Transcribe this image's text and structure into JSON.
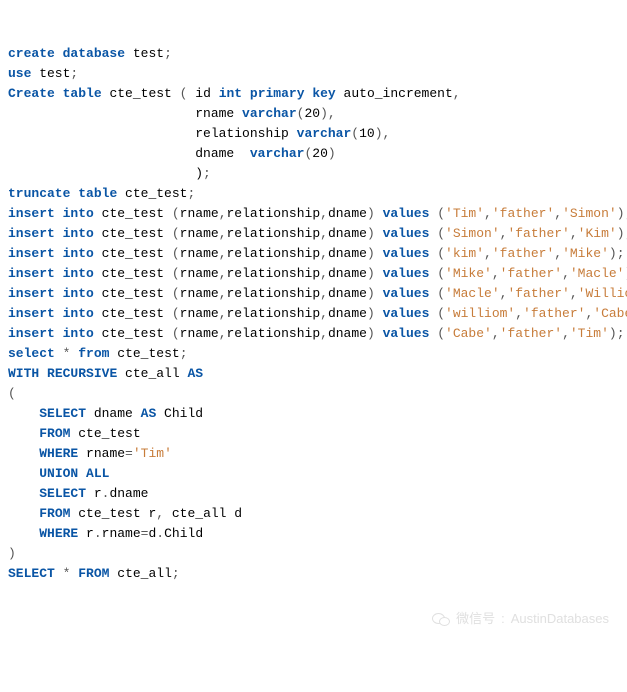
{
  "code": {
    "lines": [
      [
        [
          "create",
          "kw"
        ],
        [
          " ",
          "p"
        ],
        [
          "database",
          "kw"
        ],
        [
          " test",
          ""
        ],
        [
          ";",
          "p"
        ]
      ],
      [
        [
          "use",
          "kw"
        ],
        [
          " test",
          ""
        ],
        [
          ";",
          "p"
        ]
      ],
      [
        [
          "Create",
          "kw"
        ],
        [
          " ",
          "p"
        ],
        [
          "table",
          "kw"
        ],
        [
          " cte_test ",
          ""
        ],
        [
          "(",
          "p"
        ],
        [
          " id ",
          ""
        ],
        [
          "int",
          "kw"
        ],
        [
          " ",
          "p"
        ],
        [
          "primary",
          "kw"
        ],
        [
          " ",
          "p"
        ],
        [
          "key",
          "kw"
        ],
        [
          " auto_increment",
          ""
        ],
        [
          ",",
          "p"
        ]
      ],
      [
        [
          "                        rname ",
          ""
        ],
        [
          "varchar",
          "kw"
        ],
        [
          "(",
          "p"
        ],
        [
          "20",
          ""
        ],
        [
          ")",
          "p"
        ],
        [
          ",",
          "p"
        ]
      ],
      [
        [
          "                        relationship ",
          ""
        ],
        [
          "varchar",
          "kw"
        ],
        [
          "(",
          "p"
        ],
        [
          "10",
          ""
        ],
        [
          ")",
          "p"
        ],
        [
          ",",
          "p"
        ]
      ],
      [
        [
          "                        dname  ",
          ""
        ],
        [
          "varchar",
          "kw"
        ],
        [
          "(",
          "p"
        ],
        [
          "20",
          ""
        ],
        [
          ")",
          "p"
        ]
      ],
      [
        [
          "                        )",
          ""
        ],
        [
          ";",
          "p"
        ]
      ],
      [
        [
          "truncate",
          "kw"
        ],
        [
          " ",
          "p"
        ],
        [
          "table",
          "kw"
        ],
        [
          " cte_test",
          ""
        ],
        [
          ";",
          "p"
        ]
      ],
      [
        [
          "insert",
          "kw"
        ],
        [
          " ",
          "p"
        ],
        [
          "into",
          "kw"
        ],
        [
          " cte_test ",
          ""
        ],
        [
          "(",
          "p"
        ],
        [
          "rname",
          ""
        ],
        [
          ",",
          "p"
        ],
        [
          "relationship",
          ""
        ],
        [
          ",",
          "p"
        ],
        [
          "dname",
          ""
        ],
        [
          ")",
          "p"
        ],
        [
          " ",
          "p"
        ],
        [
          "values",
          "kw"
        ],
        [
          " ",
          "p"
        ],
        [
          "(",
          "p"
        ],
        [
          "'Tim'",
          "str"
        ],
        [
          ",",
          "p"
        ],
        [
          "'father'",
          "str"
        ],
        [
          ",",
          "p"
        ],
        [
          "'Simon'",
          "str"
        ],
        [
          ")",
          "p"
        ],
        [
          ";",
          "p"
        ]
      ],
      [
        [
          "insert",
          "kw"
        ],
        [
          " ",
          "p"
        ],
        [
          "into",
          "kw"
        ],
        [
          " cte_test ",
          ""
        ],
        [
          "(",
          "p"
        ],
        [
          "rname",
          ""
        ],
        [
          ",",
          "p"
        ],
        [
          "relationship",
          ""
        ],
        [
          ",",
          "p"
        ],
        [
          "dname",
          ""
        ],
        [
          ")",
          "p"
        ],
        [
          " ",
          "p"
        ],
        [
          "values",
          "kw"
        ],
        [
          " ",
          "p"
        ],
        [
          "(",
          "p"
        ],
        [
          "'Simon'",
          "str"
        ],
        [
          ",",
          "p"
        ],
        [
          "'father'",
          "str"
        ],
        [
          ",",
          "p"
        ],
        [
          "'Kim'",
          "str"
        ],
        [
          ")",
          "p"
        ],
        [
          ";",
          "p"
        ]
      ],
      [
        [
          "insert",
          "kw"
        ],
        [
          " ",
          "p"
        ],
        [
          "into",
          "kw"
        ],
        [
          " cte_test ",
          ""
        ],
        [
          "(",
          "p"
        ],
        [
          "rname",
          ""
        ],
        [
          ",",
          "p"
        ],
        [
          "relationship",
          ""
        ],
        [
          ",",
          "p"
        ],
        [
          "dname",
          ""
        ],
        [
          ")",
          "p"
        ],
        [
          " ",
          "p"
        ],
        [
          "values",
          "kw"
        ],
        [
          " ",
          "p"
        ],
        [
          "(",
          "p"
        ],
        [
          "'kim'",
          "str"
        ],
        [
          ",",
          "p"
        ],
        [
          "'father'",
          "str"
        ],
        [
          ",",
          "p"
        ],
        [
          "'Mike'",
          "str"
        ],
        [
          ")",
          "p"
        ],
        [
          ";",
          "p"
        ]
      ],
      [
        [
          "insert",
          "kw"
        ],
        [
          " ",
          "p"
        ],
        [
          "into",
          "kw"
        ],
        [
          " cte_test ",
          ""
        ],
        [
          "(",
          "p"
        ],
        [
          "rname",
          ""
        ],
        [
          ",",
          "p"
        ],
        [
          "relationship",
          ""
        ],
        [
          ",",
          "p"
        ],
        [
          "dname",
          ""
        ],
        [
          ")",
          "p"
        ],
        [
          " ",
          "p"
        ],
        [
          "values",
          "kw"
        ],
        [
          " ",
          "p"
        ],
        [
          "(",
          "p"
        ],
        [
          "'Mike'",
          "str"
        ],
        [
          ",",
          "p"
        ],
        [
          "'father'",
          "str"
        ],
        [
          ",",
          "p"
        ],
        [
          "'Macle'",
          "str"
        ],
        [
          ")",
          "p"
        ],
        [
          ";",
          "p"
        ]
      ],
      [
        [
          "insert",
          "kw"
        ],
        [
          " ",
          "p"
        ],
        [
          "into",
          "kw"
        ],
        [
          " cte_test ",
          ""
        ],
        [
          "(",
          "p"
        ],
        [
          "rname",
          ""
        ],
        [
          ",",
          "p"
        ],
        [
          "relationship",
          ""
        ],
        [
          ",",
          "p"
        ],
        [
          "dname",
          ""
        ],
        [
          ")",
          "p"
        ],
        [
          " ",
          "p"
        ],
        [
          "values",
          "kw"
        ],
        [
          " ",
          "p"
        ],
        [
          "(",
          "p"
        ],
        [
          "'Macle'",
          "str"
        ],
        [
          ",",
          "p"
        ],
        [
          "'father'",
          "str"
        ],
        [
          ",",
          "p"
        ],
        [
          "'Williom'",
          "str"
        ],
        [
          ")",
          "p"
        ],
        [
          ";",
          "p"
        ]
      ],
      [
        [
          "insert",
          "kw"
        ],
        [
          " ",
          "p"
        ],
        [
          "into",
          "kw"
        ],
        [
          " cte_test ",
          ""
        ],
        [
          "(",
          "p"
        ],
        [
          "rname",
          ""
        ],
        [
          ",",
          "p"
        ],
        [
          "relationship",
          ""
        ],
        [
          ",",
          "p"
        ],
        [
          "dname",
          ""
        ],
        [
          ")",
          "p"
        ],
        [
          " ",
          "p"
        ],
        [
          "values",
          "kw"
        ],
        [
          " ",
          "p"
        ],
        [
          "(",
          "p"
        ],
        [
          "'williom'",
          "str"
        ],
        [
          ",",
          "p"
        ],
        [
          "'father'",
          "str"
        ],
        [
          ",",
          "p"
        ],
        [
          "'Cabe'",
          "str"
        ],
        [
          ")",
          "p"
        ],
        [
          ";",
          "p"
        ]
      ],
      [
        [
          "insert",
          "kw"
        ],
        [
          " ",
          "p"
        ],
        [
          "into",
          "kw"
        ],
        [
          " cte_test ",
          ""
        ],
        [
          "(",
          "p"
        ],
        [
          "rname",
          ""
        ],
        [
          ",",
          "p"
        ],
        [
          "relationship",
          ""
        ],
        [
          ",",
          "p"
        ],
        [
          "dname",
          ""
        ],
        [
          ")",
          "p"
        ],
        [
          " ",
          "p"
        ],
        [
          "values",
          "kw"
        ],
        [
          " ",
          "p"
        ],
        [
          "(",
          "p"
        ],
        [
          "'Cabe'",
          "str"
        ],
        [
          ",",
          "p"
        ],
        [
          "'father'",
          "str"
        ],
        [
          ",",
          "p"
        ],
        [
          "'Tim'",
          "str"
        ],
        [
          ")",
          "p"
        ],
        [
          ";",
          "p"
        ]
      ],
      [
        [
          "",
          ""
        ]
      ],
      [
        [
          "select",
          "kw"
        ],
        [
          " ",
          "p"
        ],
        [
          "*",
          "p"
        ],
        [
          " ",
          "p"
        ],
        [
          "from",
          "kw"
        ],
        [
          " cte_test",
          ""
        ],
        [
          ";",
          "p"
        ]
      ],
      [
        [
          "",
          ""
        ]
      ],
      [
        [
          "WITH",
          "kw"
        ],
        [
          " ",
          "p"
        ],
        [
          "RECURSIVE",
          "kw"
        ],
        [
          " cte_all ",
          ""
        ],
        [
          "AS",
          "kw"
        ]
      ],
      [
        [
          "(",
          "p"
        ]
      ],
      [
        [
          "    ",
          "p"
        ],
        [
          "SELECT",
          "kw"
        ],
        [
          " dname ",
          ""
        ],
        [
          "AS",
          "kw"
        ],
        [
          " Child",
          ""
        ]
      ],
      [
        [
          "    ",
          "p"
        ],
        [
          "FROM",
          "kw"
        ],
        [
          " cte_test",
          ""
        ]
      ],
      [
        [
          "    ",
          "p"
        ],
        [
          "WHERE",
          "kw"
        ],
        [
          " rname",
          ""
        ],
        [
          "=",
          "p"
        ],
        [
          "'Tim'",
          "str"
        ]
      ],
      [
        [
          "    ",
          "p"
        ],
        [
          "UNION",
          "kw"
        ],
        [
          " ",
          "p"
        ],
        [
          "ALL",
          "kw"
        ]
      ],
      [
        [
          "    ",
          "p"
        ],
        [
          "SELECT",
          "kw"
        ],
        [
          " r",
          ""
        ],
        [
          ".",
          "p"
        ],
        [
          "dname",
          ""
        ]
      ],
      [
        [
          "    ",
          "p"
        ],
        [
          "FROM",
          "kw"
        ],
        [
          " cte_test r",
          ""
        ],
        [
          ",",
          "p"
        ],
        [
          " cte_all d",
          ""
        ]
      ],
      [
        [
          "    ",
          "p"
        ],
        [
          "WHERE",
          "kw"
        ],
        [
          " r",
          ""
        ],
        [
          ".",
          "p"
        ],
        [
          "rname",
          ""
        ],
        [
          "=",
          "p"
        ],
        [
          "d",
          ""
        ],
        [
          ".",
          "p"
        ],
        [
          "Child",
          ""
        ]
      ],
      [
        [
          "",
          ""
        ]
      ],
      [
        [
          ")",
          "p"
        ]
      ],
      [
        [
          "SELECT",
          "kw"
        ],
        [
          " ",
          "p"
        ],
        [
          "*",
          "p"
        ],
        [
          " ",
          "p"
        ],
        [
          "FROM",
          "kw"
        ],
        [
          " cte_all",
          ""
        ],
        [
          ";",
          "p"
        ]
      ]
    ]
  },
  "watermark": {
    "label": "微信号",
    "sep": ":",
    "value": "AustinDatabases"
  }
}
